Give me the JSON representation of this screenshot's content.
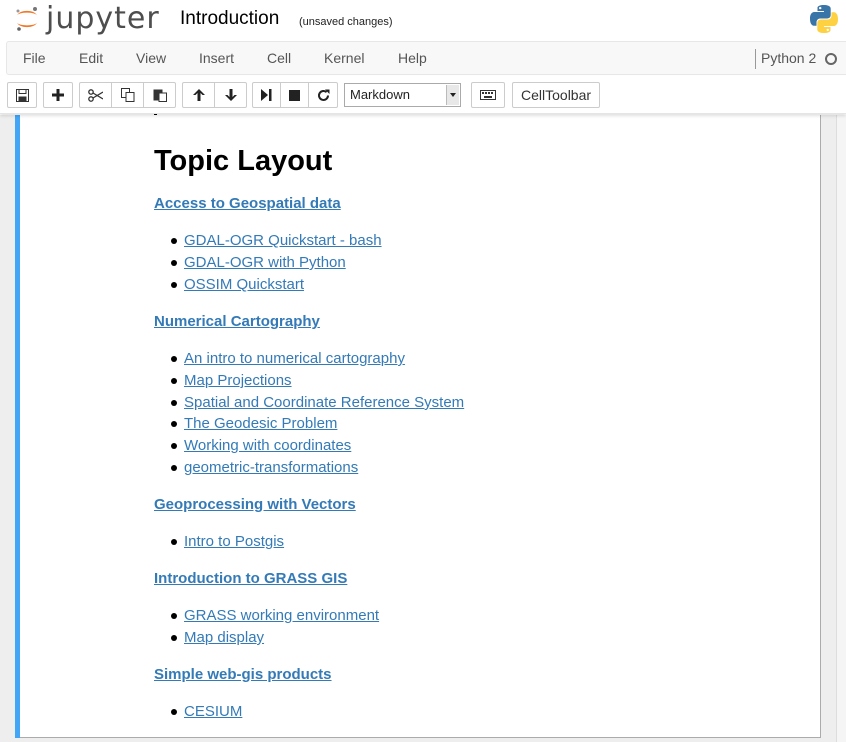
{
  "header": {
    "logo_text": "jupyter",
    "notebook_name": "Introduction",
    "save_status": "(unsaved changes)"
  },
  "menubar": {
    "items": [
      "File",
      "Edit",
      "View",
      "Insert",
      "Cell",
      "Kernel",
      "Help"
    ],
    "kernel_name": "Python 2"
  },
  "toolbar": {
    "buttons": [
      "save-icon",
      "plus-icon",
      "cut-icon",
      "copy-icon",
      "paste-icon",
      "arrow-up-icon",
      "arrow-down-icon",
      "run-icon",
      "stop-icon",
      "restart-icon",
      "keyboard-icon"
    ],
    "cell_type": "Markdown",
    "celltoolbar_label": "CellToolbar"
  },
  "colors": {
    "link": "#337ab7",
    "cell_selected_bar": "#42a5f5",
    "jupyter_orange": "#f37726"
  },
  "cell": {
    "heading": "Topic Layout",
    "sections": [
      {
        "title": "Access to Geospatial data",
        "items": [
          "GDAL-OGR Quickstart - bash",
          "GDAL-OGR with Python",
          "OSSIM Quickstart"
        ]
      },
      {
        "title": "Numerical Cartography",
        "items": [
          "An intro to numerical cartography",
          "Map Projections",
          "Spatial and Coordinate Reference System",
          "The Geodesic Problem",
          "Working with coordinates",
          "geometric-transformations"
        ]
      },
      {
        "title": "Geoprocessing with Vectors",
        "items": [
          "Intro to Postgis"
        ]
      },
      {
        "title": "Introduction to GRASS GIS",
        "items": [
          "GRASS working environment",
          "Map display"
        ]
      },
      {
        "title": "Simple web-gis products",
        "items": [
          "CESIUM"
        ]
      }
    ]
  }
}
